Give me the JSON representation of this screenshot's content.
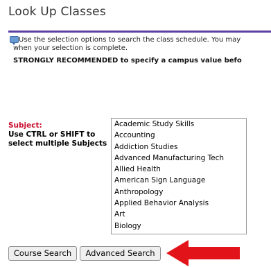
{
  "header": {
    "title": "Look Up Classes"
  },
  "info": {
    "line1": "Use the selection options to search the class schedule. You may",
    "line2": "when your selection is complete.",
    "recommend": "STRONGLY RECOMMENDED to specify a campus value befo"
  },
  "subject": {
    "label": "Subject:",
    "hint_line1": "Use CTRL or SHIFT to",
    "hint_line2": "select multiple Subjects",
    "options": [
      "Academic Study Skills",
      "Accounting",
      "Addiction Studies",
      "Advanced Manufacturing Tech",
      "Allied Health",
      "American Sign Language",
      "Anthropology",
      "Applied Behavior Analysis",
      "Art",
      "Biology"
    ]
  },
  "buttons": {
    "course_search": "Course Search",
    "advanced_search": "Advanced Search"
  },
  "colors": {
    "divider": "#5b3fa0",
    "subject_label": "#c8102e",
    "arrow": "#e2141a"
  },
  "icons": {
    "info": "info-icon",
    "arrow": "red-arrow-icon"
  }
}
